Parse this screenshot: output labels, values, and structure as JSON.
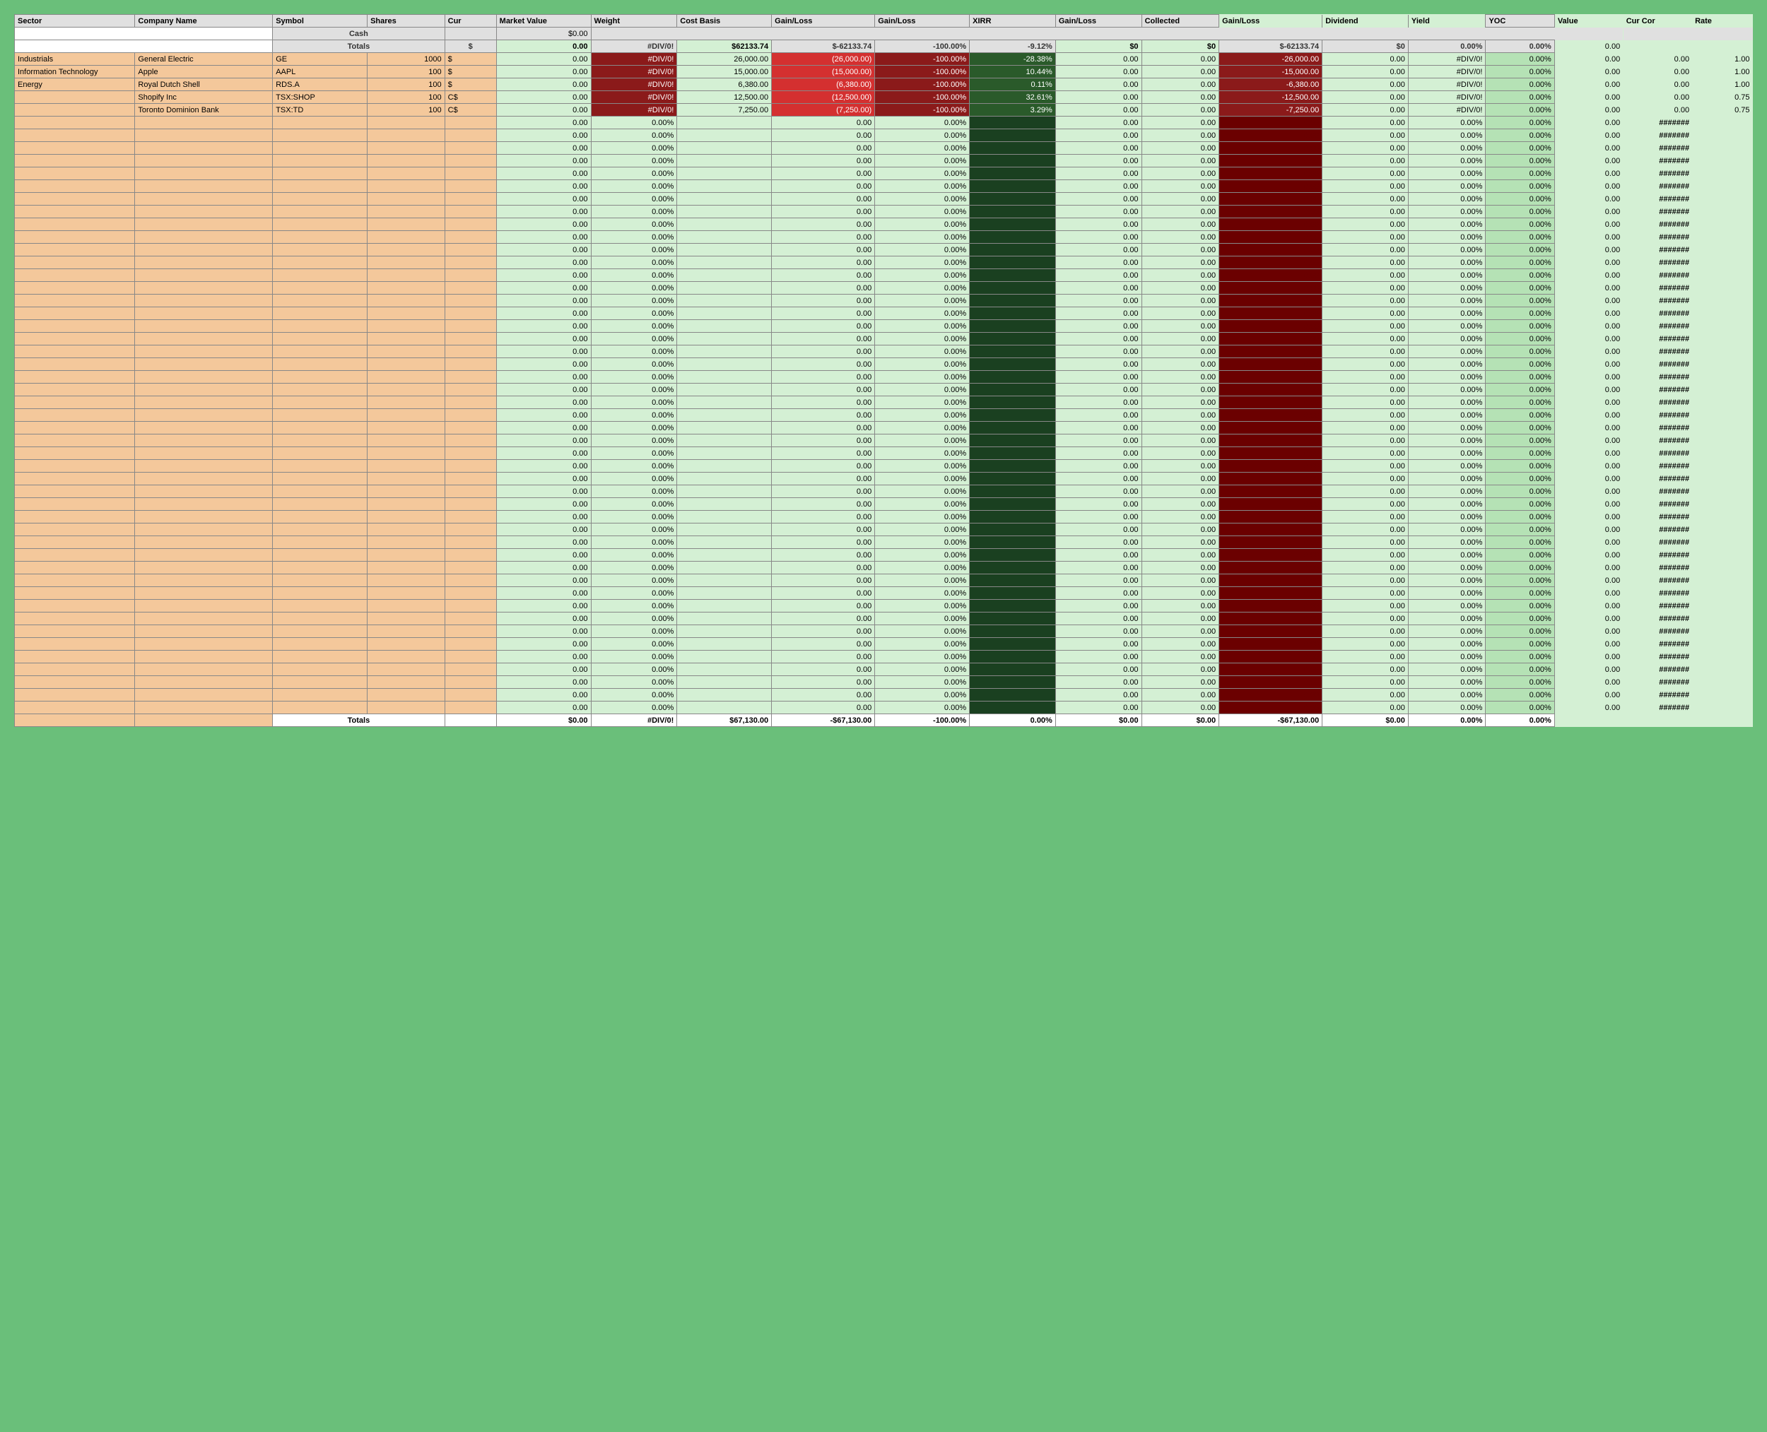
{
  "headers": [
    "Sector",
    "Company Name",
    "Symbol",
    "Shares",
    "Cur",
    "Market Value",
    "Weight",
    "Cost Basis",
    "Gain/Loss",
    "Gain/Loss",
    "XIRR",
    "Gain/Loss",
    "Collected",
    "Gain/Loss",
    "Dividend",
    "Yield",
    "YOC",
    "Value",
    "Cur Cor",
    "Rate"
  ],
  "cash_label": "Cash",
  "cash_mv": "$0.00",
  "totals_label": "Totals",
  "totals_cur": "$",
  "totals_row": {
    "mv": "0.00",
    "weight": "#DIV/0!",
    "cb": "$62133.74",
    "gl1": "$-62133.74",
    "gl2": "-100.00%",
    "xirr": "-9.12%",
    "gl3": "$0",
    "coll": "$0",
    "gl4": "$-62133.74",
    "div": "$0",
    "yield": "0.00%",
    "yoc": "0.00%",
    "val": "0.00"
  },
  "data_rows": [
    {
      "sector": "Industrials",
      "company": "General Electric",
      "symbol": "GE",
      "shares": "1000",
      "cur": "$",
      "mv": "0.00",
      "weight": "#DIV/0!",
      "cb": "26,000.00",
      "gl1": "(26,000.00)",
      "gl2": "-100.00%",
      "xirr": "-28.38%",
      "gl3": "0.00",
      "coll": "0.00",
      "gl4": "-26,000.00",
      "div": "0.00",
      "yield": "#DIV/0!",
      "yoc": "0.00%",
      "val": "0.00",
      "cc": "0.00",
      "rate": "1.00"
    },
    {
      "sector": "Information Technology",
      "company": "Apple",
      "symbol": "AAPL",
      "shares": "100",
      "cur": "$",
      "mv": "0.00",
      "weight": "#DIV/0!",
      "cb": "15,000.00",
      "gl1": "(15,000.00)",
      "gl2": "-100.00%",
      "xirr": "10.44%",
      "gl3": "0.00",
      "coll": "0.00",
      "gl4": "-15,000.00",
      "div": "0.00",
      "yield": "#DIV/0!",
      "yoc": "0.00%",
      "val": "0.00",
      "cc": "0.00",
      "rate": "1.00"
    },
    {
      "sector": "Energy",
      "company": "Royal Dutch Shell",
      "symbol": "RDS.A",
      "shares": "100",
      "cur": "$",
      "mv": "0.00",
      "weight": "#DIV/0!",
      "cb": "6,380.00",
      "gl1": "(6,380.00)",
      "gl2": "-100.00%",
      "xirr": "0.11%",
      "gl3": "0.00",
      "coll": "0.00",
      "gl4": "-6,380.00",
      "div": "0.00",
      "yield": "#DIV/0!",
      "yoc": "0.00%",
      "val": "0.00",
      "cc": "0.00",
      "rate": "1.00"
    },
    {
      "sector": "",
      "company": "Shopify Inc",
      "symbol": "TSX:SHOP",
      "shares": "100",
      "cur": "C$",
      "mv": "0.00",
      "weight": "#DIV/0!",
      "cb": "12,500.00",
      "gl1": "(12,500.00)",
      "gl2": "-100.00%",
      "xirr": "32.61%",
      "gl3": "0.00",
      "coll": "0.00",
      "gl4": "-12,500.00",
      "div": "0.00",
      "yield": "#DIV/0!",
      "yoc": "0.00%",
      "val": "0.00",
      "cc": "0.00",
      "rate": "0.75"
    },
    {
      "sector": "",
      "company": "Toronto Dominion Bank",
      "symbol": "TSX:TD",
      "shares": "100",
      "cur": "C$",
      "mv": "0.00",
      "weight": "#DIV/0!",
      "cb": "7,250.00",
      "gl1": "(7,250.00)",
      "gl2": "-100.00%",
      "xirr": "3.29%",
      "gl3": "0.00",
      "coll": "0.00",
      "gl4": "-7,250.00",
      "div": "0.00",
      "yield": "#DIV/0!",
      "yoc": "0.00%",
      "val": "0.00",
      "cc": "0.00",
      "rate": "0.75"
    }
  ],
  "empty_row": {
    "mv": "0.00",
    "weight": "0.00%",
    "gl1": "0.00",
    "gl2": "0.00%",
    "gl3": "0.00",
    "coll": "0.00",
    "gl4": "0.00",
    "div": "0.00",
    "yield": "0.00%",
    "yoc": "0.00%",
    "val": "0.00",
    "cc": "#######"
  },
  "empty_count": 47,
  "footer": {
    "label": "Totals",
    "mv": "$0.00",
    "weight": "#DIV/0!",
    "cb": "$67,130.00",
    "gl1": "-$67,130.00",
    "gl2": "-100.00%",
    "xirr": "0.00%",
    "gl3": "$0.00",
    "coll": "$0.00",
    "gl4": "-$67,130.00",
    "div": "$0.00",
    "yield": "0.00%",
    "yoc": "0.00%"
  }
}
